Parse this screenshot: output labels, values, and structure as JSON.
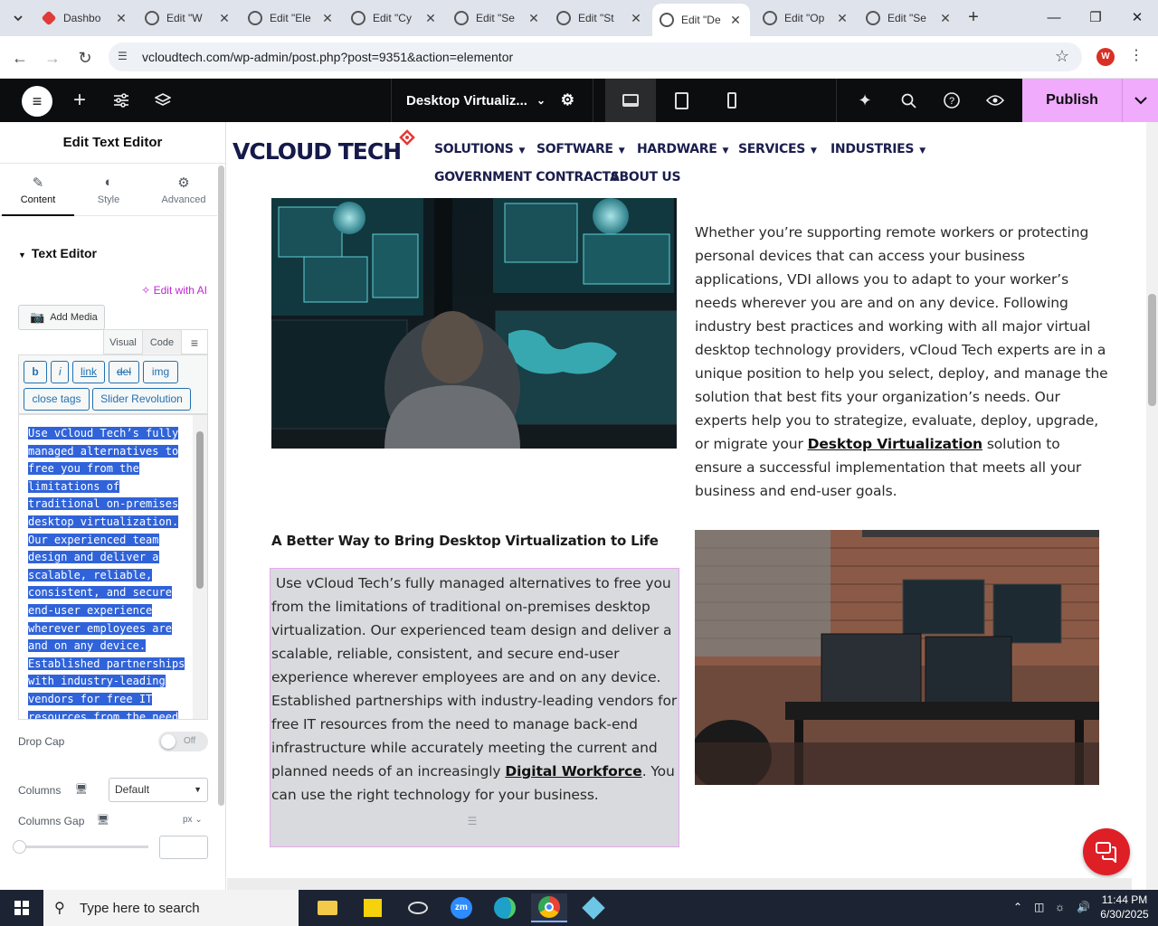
{
  "browser": {
    "tabs": [
      {
        "title": "Dashbo",
        "icon": "wordpress-dashboard-icon"
      },
      {
        "title": "Edit \"W",
        "icon": "wordpress-icon"
      },
      {
        "title": "Edit \"Ele",
        "icon": "wordpress-icon"
      },
      {
        "title": "Edit \"Cy",
        "icon": "wordpress-icon"
      },
      {
        "title": "Edit \"Se",
        "icon": "wordpress-icon"
      },
      {
        "title": "Edit \"St",
        "icon": "wordpress-icon"
      },
      {
        "title": "Edit \"De",
        "icon": "wordpress-icon",
        "active": true
      },
      {
        "title": "Edit \"Op",
        "icon": "wordpress-icon"
      },
      {
        "title": "Edit \"Se",
        "icon": "wordpress-icon"
      }
    ],
    "url": "vcloudtech.com/wp-admin/post.php?post=9351&action=elementor",
    "profile_initial": "W"
  },
  "elementor": {
    "document_title": "Desktop Virtualiz...",
    "publish_label": "Publish",
    "accent_color": "#f0abfc"
  },
  "panel": {
    "title": "Edit Text Editor",
    "tabs": [
      {
        "label": "Content"
      },
      {
        "label": "Style"
      },
      {
        "label": "Advanced"
      }
    ],
    "section": "Text Editor",
    "edit_with_ai": "Edit with AI",
    "add_media": "Add Media",
    "visual_tab": "Visual",
    "code_tab": "Code",
    "quicktags": [
      "b",
      "i",
      "link",
      "del",
      "img",
      "close tags",
      "Slider Revolution"
    ],
    "textarea_lines": [
      "Use vCloud Tech’s fully",
      "managed alternatives to",
      "free you from the",
      "limitations of",
      "traditional on-premises",
      "desktop virtualization.",
      "Our experienced team",
      "design and deliver a",
      "scalable, reliable,",
      "consistent, and secure",
      "end-user experience",
      "wherever employees are",
      "and on any device.",
      "Established partnerships",
      "with industry-leading",
      "vendors for free IT",
      "resources from the need"
    ],
    "drop_cap_label": "Drop Cap",
    "drop_cap_value": "Off",
    "columns_label": "Columns",
    "columns_value": "Default",
    "columns_gap_label": "Columns Gap",
    "columns_gap_unit": "px"
  },
  "site": {
    "logo_text": "VCLOUD TECH",
    "menu": [
      {
        "label": "SOLUTIONS",
        "dropdown": true
      },
      {
        "label": "SOFTWARE",
        "dropdown": true
      },
      {
        "label": "HARDWARE",
        "dropdown": true
      },
      {
        "label": "SERVICES",
        "dropdown": true
      },
      {
        "label": "INDUSTRIES",
        "dropdown": true
      },
      {
        "label": "GOVERNMENT CONTRACTS",
        "dropdown": false
      },
      {
        "label": "ABOUT US",
        "dropdown": false
      }
    ],
    "right_para_before": "Whether you’re supporting remote workers or protecting personal devices that can access your business applications, VDI allows you to adapt to your worker’s needs wherever you are and on any device. Following industry best practices and working with all major virtual desktop technology providers, vCloud Tech experts are in a unique position to help you select, deploy, and manage the solution that best fits your organization’s needs. Our experts help you to strategize, evaluate, deploy, upgrade, or migrate your",
    "right_para_link": "Desktop Virtualization",
    "right_para_after": "solution to ensure a successful implementation that meets all your business and end-user goals.",
    "heading": "A Better Way to Bring Desktop Virtualization to Life",
    "left_para_before": "Use vCloud Tech’s fully managed alternatives to free you from the limitations of traditional on-premises desktop virtualization. Our experienced team design and deliver a scalable, reliable, consistent, and secure end-user experience wherever employees are and on any device. Established partnerships with industry-leading vendors for free IT resources from the need to manage back-end infrastructure while accurately meeting the current and planned needs of an increasingly",
    "left_para_link": "Digital Workforce",
    "left_para_after": ". You can use the right technology for your business."
  },
  "taskbar": {
    "search_placeholder": "Type here to search",
    "time": "11:44 PM",
    "date": "6/30/2025"
  }
}
